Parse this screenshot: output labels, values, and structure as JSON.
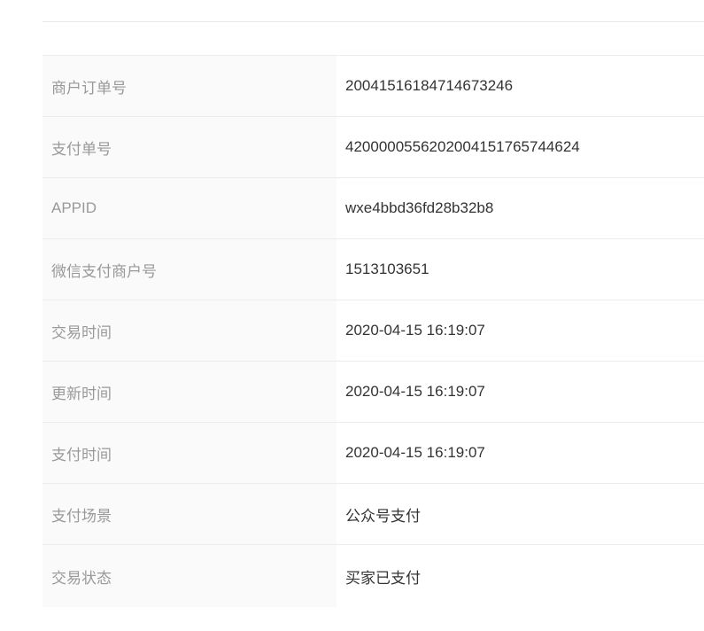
{
  "order_details": {
    "rows": [
      {
        "label": "商户订单号",
        "value": "20041516184714673246"
      },
      {
        "label": "支付单号",
        "value": "4200000556202004151765744624"
      },
      {
        "label": "APPID",
        "value": "wxe4bbd36fd28b32b8"
      },
      {
        "label": "微信支付商户号",
        "value": "1513103651"
      },
      {
        "label": "交易时间",
        "value": "2020-04-15 16:19:07"
      },
      {
        "label": "更新时间",
        "value": "2020-04-15 16:19:07"
      },
      {
        "label": "支付时间",
        "value": "2020-04-15 16:19:07"
      },
      {
        "label": "支付场景",
        "value": "公众号支付"
      },
      {
        "label": "交易状态",
        "value": "买家已支付"
      }
    ]
  }
}
